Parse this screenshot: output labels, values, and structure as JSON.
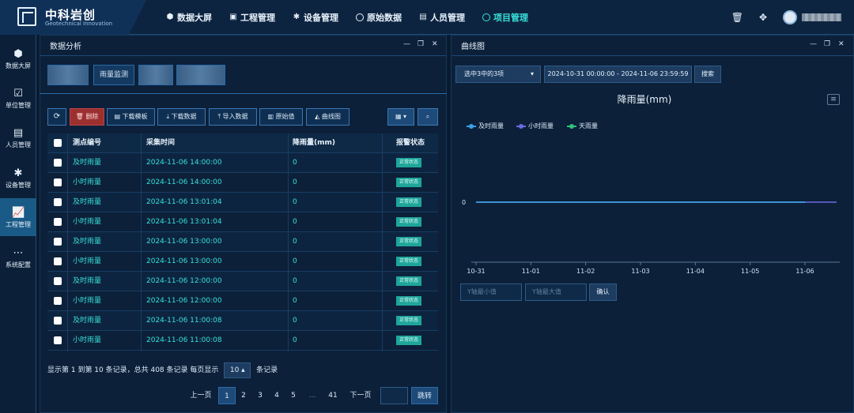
{
  "header": {
    "brand_title": "中科岩创",
    "brand_subtitle": "Geotechnical Innovation",
    "nav": [
      {
        "label": "数据大屏",
        "icon": "cube-icon"
      },
      {
        "label": "工程管理",
        "icon": "monitor-icon"
      },
      {
        "label": "设备管理",
        "icon": "gear-icon"
      },
      {
        "label": "原始数据",
        "icon": "circle-icon"
      },
      {
        "label": "人员管理",
        "icon": "document-user-icon"
      },
      {
        "label": "项目管理",
        "icon": "circle-icon",
        "active": true
      }
    ]
  },
  "sidebar": {
    "items": [
      {
        "label": "数据大屏",
        "icon": "cube-icon"
      },
      {
        "label": "单位管理",
        "icon": "calendar-check-icon"
      },
      {
        "label": "人员管理",
        "icon": "document-user-icon"
      },
      {
        "label": "设备管理",
        "icon": "gear-icon"
      },
      {
        "label": "工程管理",
        "icon": "chart-icon",
        "active": true
      },
      {
        "label": "系统配置",
        "icon": "more-icon"
      }
    ]
  },
  "left_panel": {
    "title": "数据分析",
    "filter_buttons": [
      "雨量监测"
    ],
    "toolbar": {
      "delete": "删除",
      "download_template": "下载模板",
      "download_data": "下载数据",
      "import_data": "导入数据",
      "raw_value": "原始值",
      "curve_chart": "曲线图"
    },
    "table": {
      "headers": [
        "测点编号",
        "采集时间",
        "降雨量(mm)",
        "报警状态"
      ],
      "rows": [
        {
          "id": "及时雨量",
          "time": "2024-11-06 14:00:00",
          "value": "0",
          "status": "正常状态"
        },
        {
          "id": "小时雨量",
          "time": "2024-11-06 14:00:00",
          "value": "0",
          "status": "正常状态"
        },
        {
          "id": "及时雨量",
          "time": "2024-11-06 13:01:04",
          "value": "0",
          "status": "正常状态"
        },
        {
          "id": "小时雨量",
          "time": "2024-11-06 13:01:04",
          "value": "0",
          "status": "正常状态"
        },
        {
          "id": "及时雨量",
          "time": "2024-11-06 13:00:00",
          "value": "0",
          "status": "正常状态"
        },
        {
          "id": "小时雨量",
          "time": "2024-11-06 13:00:00",
          "value": "0",
          "status": "正常状态"
        },
        {
          "id": "及时雨量",
          "time": "2024-11-06 12:00:00",
          "value": "0",
          "status": "正常状态"
        },
        {
          "id": "小时雨量",
          "time": "2024-11-06 12:00:00",
          "value": "0",
          "status": "正常状态"
        },
        {
          "id": "及时雨量",
          "time": "2024-11-06 11:00:08",
          "value": "0",
          "status": "正常状态"
        },
        {
          "id": "小时雨量",
          "time": "2024-11-06 11:00:08",
          "value": "0",
          "status": "正常状态"
        }
      ]
    },
    "pagination": {
      "info_prefix": "显示第 1 到第 10 条记录，总共 408 条记录 每页显示",
      "page_size": "10",
      "info_suffix": "条记录",
      "prev": "上一页",
      "pages": [
        "1",
        "2",
        "3",
        "4",
        "5",
        "...",
        "41"
      ],
      "next": "下一页",
      "jump": "跳转"
    }
  },
  "right_panel": {
    "title": "曲线图",
    "select_value": "选中3中的3项",
    "date_range": "2024-10-31 00:00:00 - 2024-11-06 23:59:59",
    "search": "搜索",
    "y_min_placeholder": "Y轴最小值",
    "y_max_placeholder": "Y轴最大值",
    "confirm": "确认"
  },
  "chart_data": {
    "type": "line",
    "title": "降雨量(mm)",
    "x": [
      "10-31",
      "11-01",
      "11-02",
      "11-03",
      "11-04",
      "11-05",
      "11-06"
    ],
    "yticks": [
      "0"
    ],
    "series": [
      {
        "name": "及时雨量",
        "color": "#3aa0e8",
        "values": [
          0,
          0,
          0,
          0,
          0,
          0,
          0
        ]
      },
      {
        "name": "小时雨量",
        "color": "#6a6adf",
        "values": [
          0,
          0,
          0,
          0,
          0,
          0,
          0
        ]
      },
      {
        "name": "天雨量",
        "color": "#2ec27e",
        "values": [
          0,
          0,
          0,
          0,
          0,
          0,
          0
        ]
      }
    ]
  }
}
